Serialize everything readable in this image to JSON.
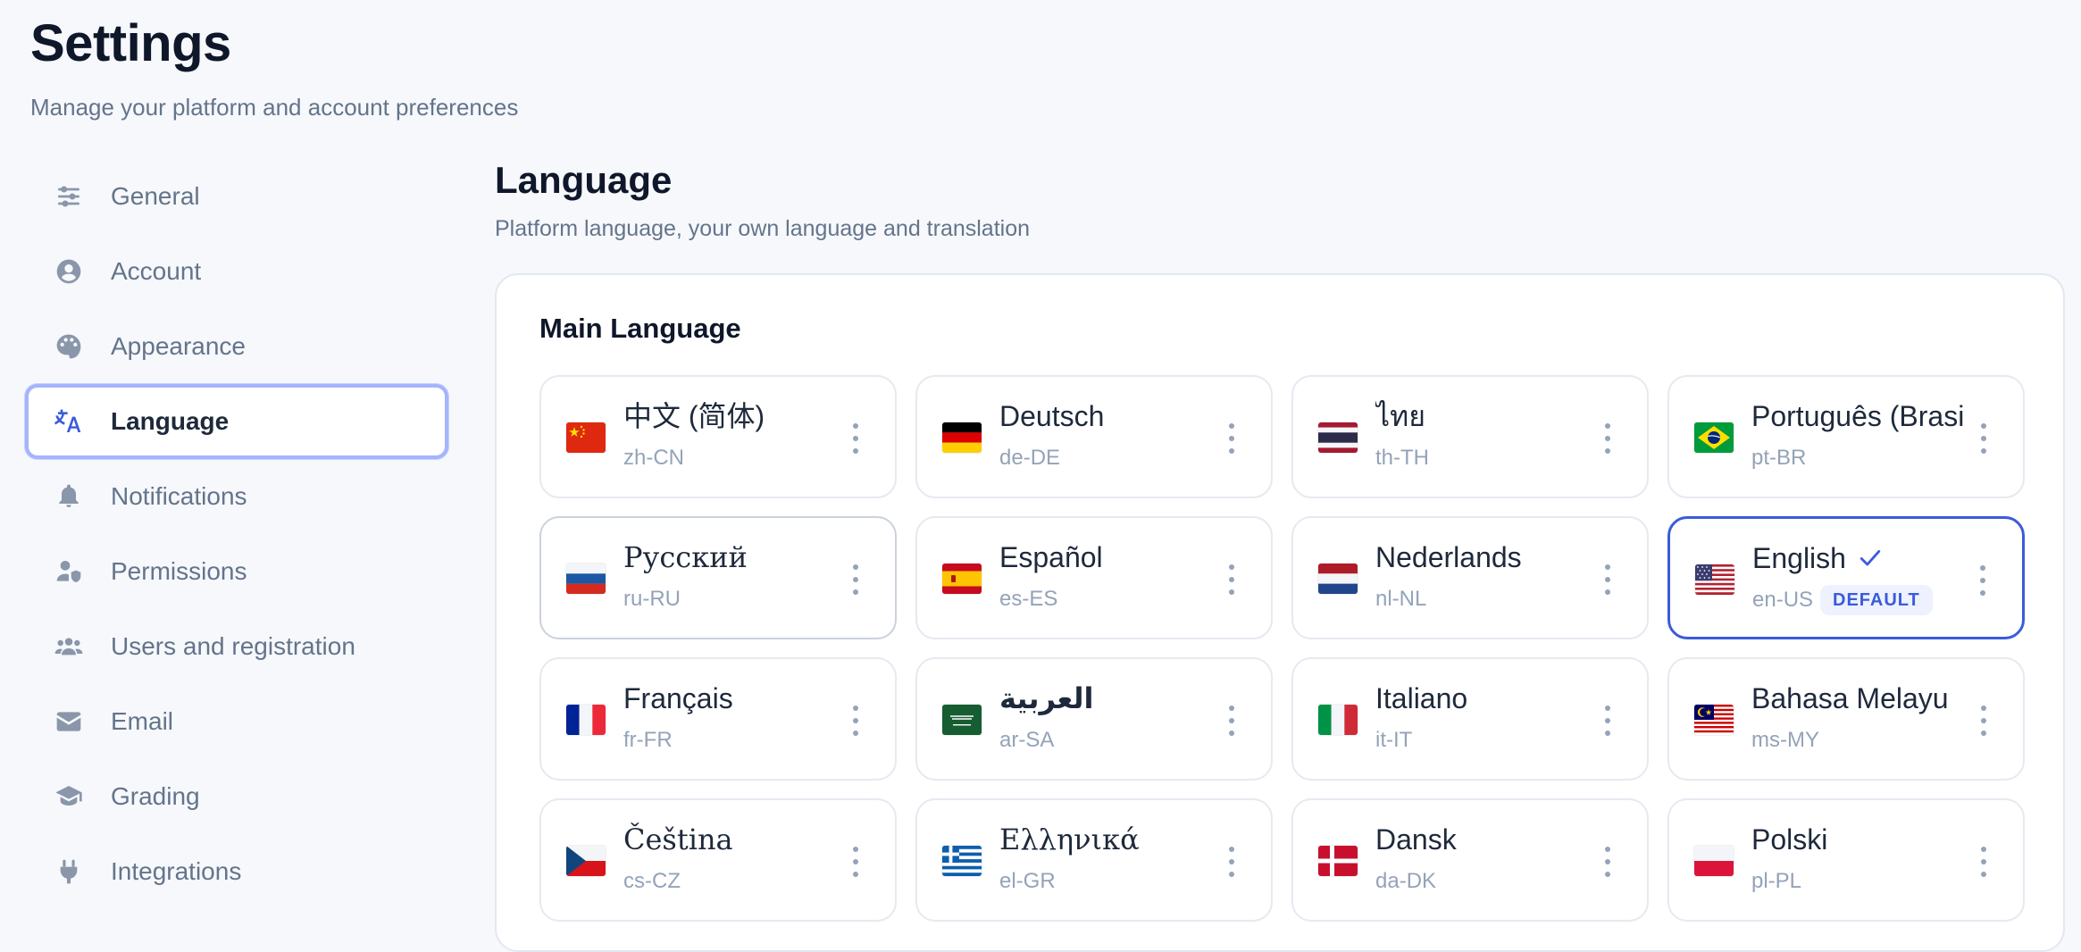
{
  "header": {
    "title": "Settings",
    "subtitle": "Manage your platform and account preferences"
  },
  "sidebar": {
    "items": [
      {
        "label": "General",
        "icon": "sliders-icon"
      },
      {
        "label": "Account",
        "icon": "user-circle-icon"
      },
      {
        "label": "Appearance",
        "icon": "palette-icon"
      },
      {
        "label": "Language",
        "icon": "translate-icon",
        "active": true
      },
      {
        "label": "Notifications",
        "icon": "bell-icon"
      },
      {
        "label": "Permissions",
        "icon": "user-shield-icon"
      },
      {
        "label": "Users and registration",
        "icon": "users-icon"
      },
      {
        "label": "Email",
        "icon": "envelope-icon"
      },
      {
        "label": "Grading",
        "icon": "graduation-cap-icon"
      },
      {
        "label": "Integrations",
        "icon": "plug-icon"
      }
    ]
  },
  "section": {
    "title": "Language",
    "subtitle": "Platform language, your own language and translation"
  },
  "main_language": {
    "title": "Main Language",
    "default_badge": "DEFAULT",
    "languages": [
      {
        "name": "中文 (简体)",
        "code": "zh-CN",
        "flag": "china-flag-icon"
      },
      {
        "name": "Deutsch",
        "code": "de-DE",
        "flag": "germany-flag-icon"
      },
      {
        "name": "ไทย",
        "code": "th-TH",
        "flag": "thailand-flag-icon"
      },
      {
        "name": "Português (Brasil)",
        "code": "pt-BR",
        "flag": "brazil-flag-icon"
      },
      {
        "name": "Русский",
        "code": "ru-RU",
        "flag": "russia-flag-icon"
      },
      {
        "name": "Español",
        "code": "es-ES",
        "flag": "spain-flag-icon"
      },
      {
        "name": "Nederlands",
        "code": "nl-NL",
        "flag": "netherlands-flag-icon"
      },
      {
        "name": "English",
        "code": "en-US",
        "flag": "usa-flag-icon",
        "selected": true
      },
      {
        "name": "Français",
        "code": "fr-FR",
        "flag": "france-flag-icon"
      },
      {
        "name": "العربية",
        "code": "ar-SA",
        "flag": "saudi-arabia-flag-icon"
      },
      {
        "name": "Italiano",
        "code": "it-IT",
        "flag": "italy-flag-icon"
      },
      {
        "name": "Bahasa Melayu",
        "code": "ms-MY",
        "flag": "malaysia-flag-icon"
      },
      {
        "name": "Čeština",
        "code": "cs-CZ",
        "flag": "czech-flag-icon"
      },
      {
        "name": "Ελληνικά",
        "code": "el-GR",
        "flag": "greece-flag-icon"
      },
      {
        "name": "Dansk",
        "code": "da-DK",
        "flag": "denmark-flag-icon"
      },
      {
        "name": "Polski",
        "code": "pl-PL",
        "flag": "poland-flag-icon"
      }
    ]
  },
  "colors": {
    "accent": "#3b5bdb",
    "active_border": "#a5b4fc",
    "muted_text": "#64748b",
    "background": "#f6f8fb"
  }
}
